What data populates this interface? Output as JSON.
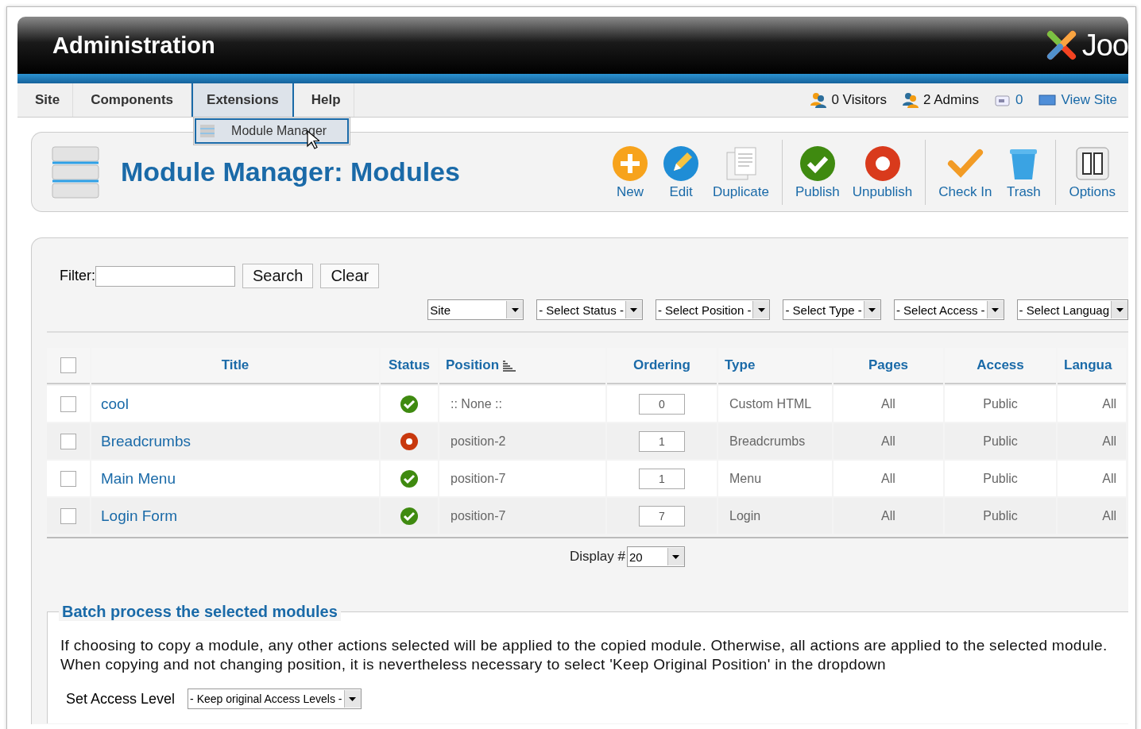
{
  "header": {
    "title": "Administration",
    "logo_text": "Joo"
  },
  "menu": {
    "items": [
      {
        "label": "Site",
        "selected": false
      },
      {
        "label": "Components",
        "selected": false
      },
      {
        "label": "Extensions",
        "selected": true
      },
      {
        "label": "Help",
        "selected": false
      }
    ],
    "dropdown": [
      {
        "label": "Module Manager",
        "selected": true
      }
    ]
  },
  "status": {
    "visitors": "0 Visitors",
    "admins": "2 Admins",
    "messages": "0",
    "view_site": "View Site"
  },
  "page_title": "Module Manager: Modules",
  "toolbar": [
    [
      {
        "label": "New",
        "kind": "new"
      },
      {
        "label": "Edit",
        "kind": "edit"
      },
      {
        "label": "Duplicate",
        "kind": "duplicate"
      }
    ],
    [
      {
        "label": "Publish",
        "kind": "publish"
      },
      {
        "label": "Unpublish",
        "kind": "unpublish"
      }
    ],
    [
      {
        "label": "Check In",
        "kind": "checkin"
      },
      {
        "label": "Trash",
        "kind": "trash"
      }
    ],
    [
      {
        "label": "Options",
        "kind": "options"
      }
    ]
  ],
  "filter": {
    "label": "Filter:",
    "buttons": [
      "Search",
      "Clear"
    ],
    "selects": [
      "Site",
      "- Select Status -",
      "- Select Position -",
      "- Select Type -",
      "- Select Access -",
      "- Select Languag"
    ]
  },
  "table": {
    "columns": [
      {
        "kind": "checkbox",
        "checked": false
      },
      {
        "label": "Title",
        "kind": "text"
      },
      {
        "label": "Status",
        "kind": "text"
      },
      {
        "label": "Position",
        "kind": "sorted"
      },
      {
        "label": "Ordering",
        "kind": "text"
      },
      {
        "label": "Type",
        "kind": "text"
      },
      {
        "label": "Pages",
        "kind": "text"
      },
      {
        "label": "Access",
        "kind": "text"
      },
      {
        "label": "Langua",
        "kind": "text"
      }
    ],
    "rows": [
      {
        "checked": false,
        "title": "cool",
        "published": true,
        "position": ":: None ::",
        "ordering": "0",
        "type": "Custom HTML",
        "pages": "All",
        "access": "Public",
        "language": "All"
      },
      {
        "checked": false,
        "title": "Breadcrumbs",
        "published": false,
        "position": "position-2",
        "ordering": "1",
        "type": "Breadcrumbs",
        "pages": "All",
        "access": "Public",
        "language": "All"
      },
      {
        "checked": false,
        "title": "Main Menu",
        "published": true,
        "position": "position-7",
        "ordering": "1",
        "type": "Menu",
        "pages": "All",
        "access": "Public",
        "language": "All"
      },
      {
        "checked": false,
        "title": "Login Form",
        "published": true,
        "position": "position-7",
        "ordering": "7",
        "type": "Login",
        "pages": "All",
        "access": "Public",
        "language": "All"
      }
    ]
  },
  "pagination": {
    "label": "Display #",
    "value": "20"
  },
  "batch": {
    "legend": "Batch process the selected modules",
    "text": "If choosing to copy a module, any other actions selected will be applied to the copied module. Otherwise, all actions are applied to the selected module. When copying and not changing position, it is nevertheless necessary to select 'Keep Original Position' in the dropdown",
    "access_label": "Set Access Level",
    "access_value": "- Keep original Access Levels -"
  }
}
